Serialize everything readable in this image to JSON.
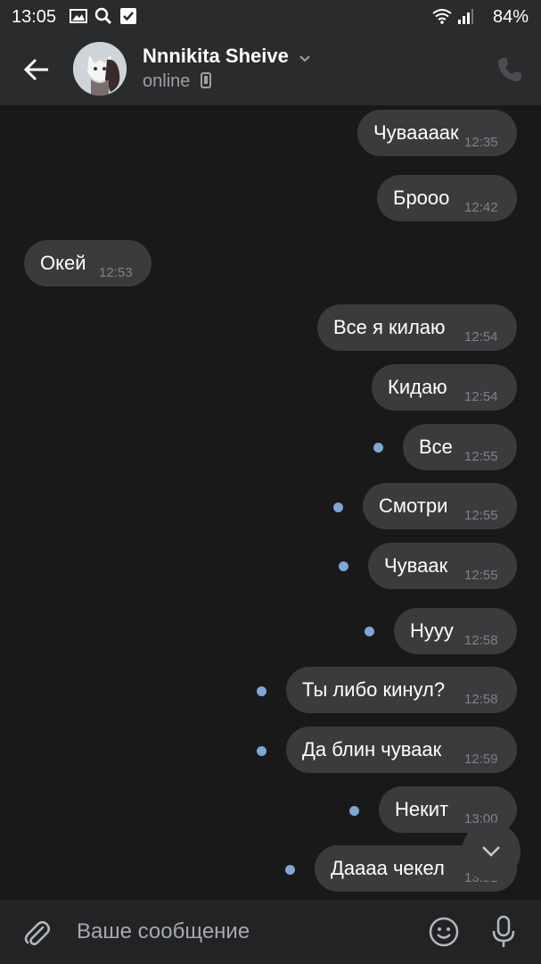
{
  "status_bar": {
    "time": "13:05",
    "battery": "84%",
    "icons": [
      "image-icon",
      "search-icon",
      "checkbox-icon",
      "wifi-icon",
      "signal-icon",
      "battery-icon"
    ]
  },
  "header": {
    "name": "Nnnikita Sheive",
    "status": "online",
    "icons": [
      "back-arrow-icon",
      "chevron-down-icon",
      "mobile-device-icon",
      "phone-icon"
    ]
  },
  "messages": [
    {
      "text": "Чуваааак",
      "time": "12:35",
      "outgoing": true,
      "unread": false
    },
    {
      "text": "Брооо",
      "time": "12:42",
      "outgoing": true,
      "unread": false
    },
    {
      "text": "Окей",
      "time": "12:53",
      "outgoing": false,
      "unread": false
    },
    {
      "text": "Все я килаю",
      "time": "12:54",
      "outgoing": true,
      "unread": false
    },
    {
      "text": "Кидаю",
      "time": "12:54",
      "outgoing": true,
      "unread": false
    },
    {
      "text": "Все",
      "time": "12:55",
      "outgoing": true,
      "unread": true
    },
    {
      "text": "Смотри",
      "time": "12:55",
      "outgoing": true,
      "unread": true
    },
    {
      "text": "Чуваак",
      "time": "12:55",
      "outgoing": true,
      "unread": true
    },
    {
      "text": "Нууу",
      "time": "12:58",
      "outgoing": true,
      "unread": true
    },
    {
      "text": "Ты либо кинул?",
      "time": "12:58",
      "outgoing": true,
      "unread": true
    },
    {
      "text": "Да блин чуваак",
      "time": "12:59",
      "outgoing": true,
      "unread": true
    },
    {
      "text": "Некит",
      "time": "13:00",
      "outgoing": true,
      "unread": true
    },
    {
      "text": "Даааа чекел",
      "time": "13:01",
      "outgoing": true,
      "unread": true
    }
  ],
  "composer": {
    "placeholder": "Ваше сообщение",
    "icons": [
      "attach-icon",
      "emoji-icon",
      "microphone-icon"
    ]
  },
  "colors": {
    "background": "#19191a",
    "header": "#2a2b2c",
    "bubble": "#3a3b3d",
    "unread_dot": "#7ea6d8",
    "time_text": "#7e8185"
  }
}
